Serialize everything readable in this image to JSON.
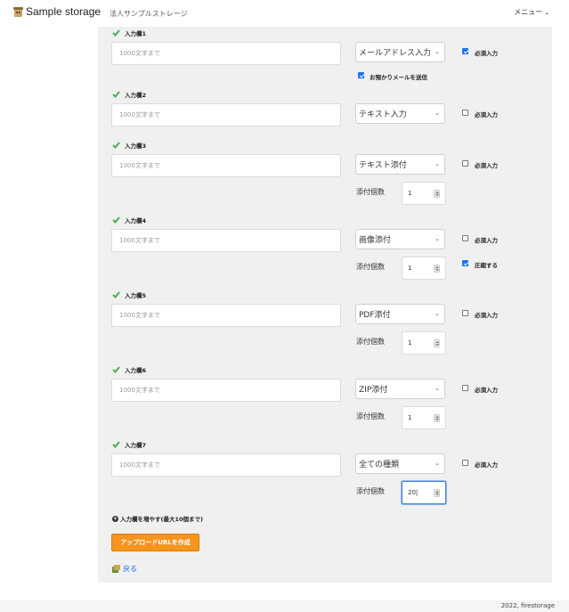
{
  "header": {
    "logo_text": "Sample storage",
    "company_name": "法人サンプルストレージ",
    "menu_label": "メニュー",
    "menu_chevron": "⌄"
  },
  "fields": [
    {
      "title": "入力欄1",
      "placeholder": "1000文字まで",
      "type": "メールアドレス入力",
      "required_label": "必須入力",
      "required": true,
      "extra_check_label": "お預かりメールを送信",
      "extra_check": true
    },
    {
      "title": "入力欄2",
      "placeholder": "1000文字まで",
      "type": "テキスト入力",
      "required_label": "必須入力",
      "required": false
    },
    {
      "title": "入力欄3",
      "placeholder": "1000文字まで",
      "type": "テキスト添付",
      "required_label": "必須入力",
      "required": false,
      "count_label": "添付個数",
      "count": "1"
    },
    {
      "title": "入力欄4",
      "placeholder": "1000文字まで",
      "type": "画像添付",
      "required_label": "必須入力",
      "required": false,
      "count_label": "添付個数",
      "count": "1",
      "compress_label": "圧縮する",
      "compress": true
    },
    {
      "title": "入力欄5",
      "placeholder": "1000文字まで",
      "type": "PDF添付",
      "required_label": "必須入力",
      "required": false,
      "count_label": "添付個数",
      "count": "1"
    },
    {
      "title": "入力欄6",
      "placeholder": "1000文字まで",
      "type": "ZIP添付",
      "required_label": "必須入力",
      "required": false,
      "count_label": "添付個数",
      "count": "1"
    },
    {
      "title": "入力欄7",
      "placeholder": "1000文字まで",
      "type": "全ての種類",
      "required_label": "必須入力",
      "required": false,
      "count_label": "添付個数",
      "count": "20|"
    }
  ],
  "actions": {
    "add_fields_label": "入力欄を増やす(最大10個まで)",
    "create_button_label": "アップロードURLを作成",
    "back_label": "戻る"
  },
  "footer": {
    "copyright": "2022, firestorage"
  },
  "colors": {
    "accent_blue": "#1a73e8",
    "button_orange": "#f7941d",
    "check_green": "#4caf50",
    "panel_bg": "#f0f0f0"
  },
  "icons": [
    "logo-icon",
    "check-icon",
    "chevron-down-icon",
    "plus-circle-icon",
    "back-icon"
  ]
}
